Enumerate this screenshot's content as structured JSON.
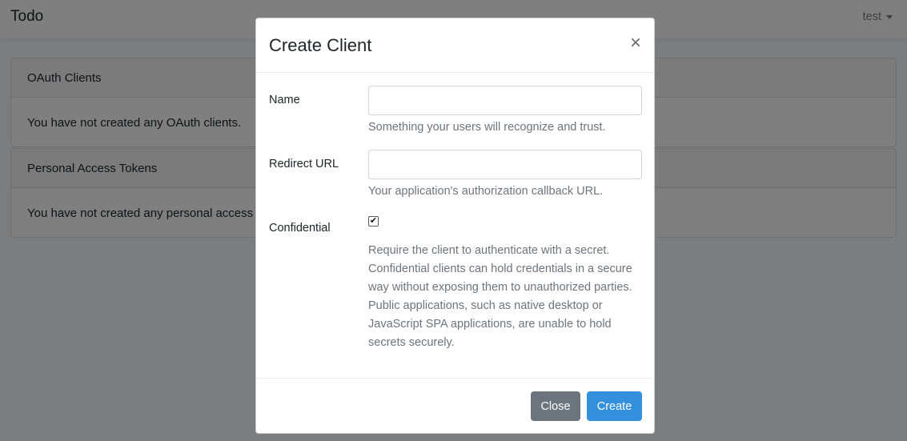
{
  "navbar": {
    "brand": "Todo",
    "user_name": "test"
  },
  "cards": [
    {
      "header": "OAuth Clients",
      "body": "You have not created any OAuth clients."
    },
    {
      "header": "Personal Access Tokens",
      "body": "You have not created any personal access tokens."
    }
  ],
  "modal": {
    "title": "Create Client",
    "close_symbol": "×",
    "fields": {
      "name": {
        "label": "Name",
        "value": "",
        "help": "Something your users will recognize and trust."
      },
      "redirect": {
        "label": "Redirect URL",
        "value": "",
        "help": "Your application's authorization callback URL."
      },
      "confidential": {
        "label": "Confidential",
        "checked": true,
        "check_glyph": "✔",
        "help_lines": [
          "Require the client to authenticate with a secret.",
          "Confidential clients can hold credentials in a secure",
          "way without exposing them to unauthorized parties.",
          "Public applications, such as native desktop or",
          "JavaScript SPA applications, are unable to hold",
          "secrets securely."
        ]
      }
    },
    "buttons": {
      "close": "Close",
      "create": "Create"
    }
  },
  "colors": {
    "primary": "#3490dc",
    "secondary": "#6c757d",
    "backdrop": "rgba(0,0,0,0.5)"
  },
  "icons": {
    "user_menu": "caret-down-icon",
    "modal_close": "close-icon",
    "checkbox": "checkmark-icon"
  }
}
